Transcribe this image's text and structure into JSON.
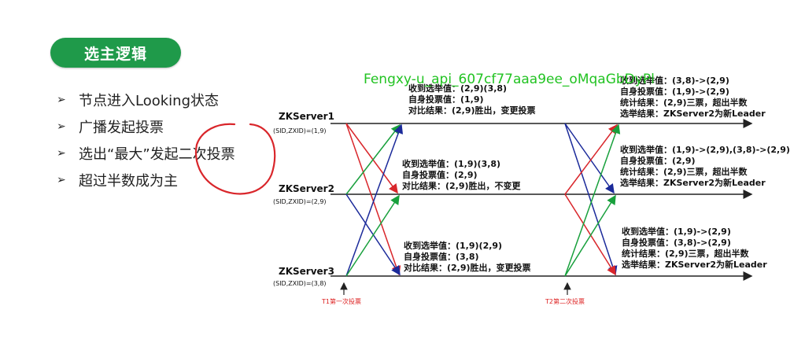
{
  "title": "选主逻辑",
  "bullets": [
    "节点进入Looking状态",
    "广播发起投票",
    "选出“最大”发起二次投票",
    "超过半数成为主"
  ],
  "servers": [
    {
      "name": "ZKServer1",
      "sid": "(SID,ZXID)=(1,9)"
    },
    {
      "name": "ZKServer2",
      "sid": "(SID,ZXID)=(2,9)"
    },
    {
      "name": "ZKServer3",
      "sid": "(SID,ZXID)=(3,8)"
    }
  ],
  "round1": [
    {
      "received": "收到选举值：(2,9)(3,8)",
      "self": "自身投票值：(1,9)",
      "compare": "对比结果：(2,9)胜出，变更投票"
    },
    {
      "received": "收到选举值：(1,9)(3,8)",
      "self": "自身投票值：(2,9)",
      "compare": "对比结果：(2,9)胜出，不变更"
    },
    {
      "received": "收到选举值：(1,9)(2,9)",
      "self": "自身投票值：(3,8)",
      "compare": "对比结果：(2,9)胜出，变更投票"
    }
  ],
  "round2": [
    {
      "received": "收到选举值：(3,8)->(2,9)",
      "self": "自身投票值：(1,9)->(2,9)",
      "stats": "统计结果：(2,9)三票，超出半数",
      "result": "选举结果：ZKServer2为新Leader"
    },
    {
      "received": "收到选举值：(1,9)->(2,9),(3,8)->(2,9)",
      "self": "自身投票值：(2,9)",
      "stats": "统计结果：(2,9)三票，超出半数",
      "result": "选举结果：ZKServer2为新Leader"
    },
    {
      "received": "收到选举值：(1,9)->(2,9)",
      "self": "自身投票值：(3,8)->(2,9)",
      "stats": "统计结果：(2,9)三票，超出半数",
      "result": "选举结果：ZKServer2为新Leader"
    }
  ],
  "t1_label": "T1第一次投票",
  "t2_label": "T2第二次投票",
  "watermark": "Fengxy-u_api_607cf77aaa9ee_oMqaGbDyPl",
  "colors": {
    "accent": "#1f9a4a",
    "red": "#d9262b",
    "blue": "#1b2a9a",
    "green": "#18a03c",
    "watermark": "#22c322"
  }
}
